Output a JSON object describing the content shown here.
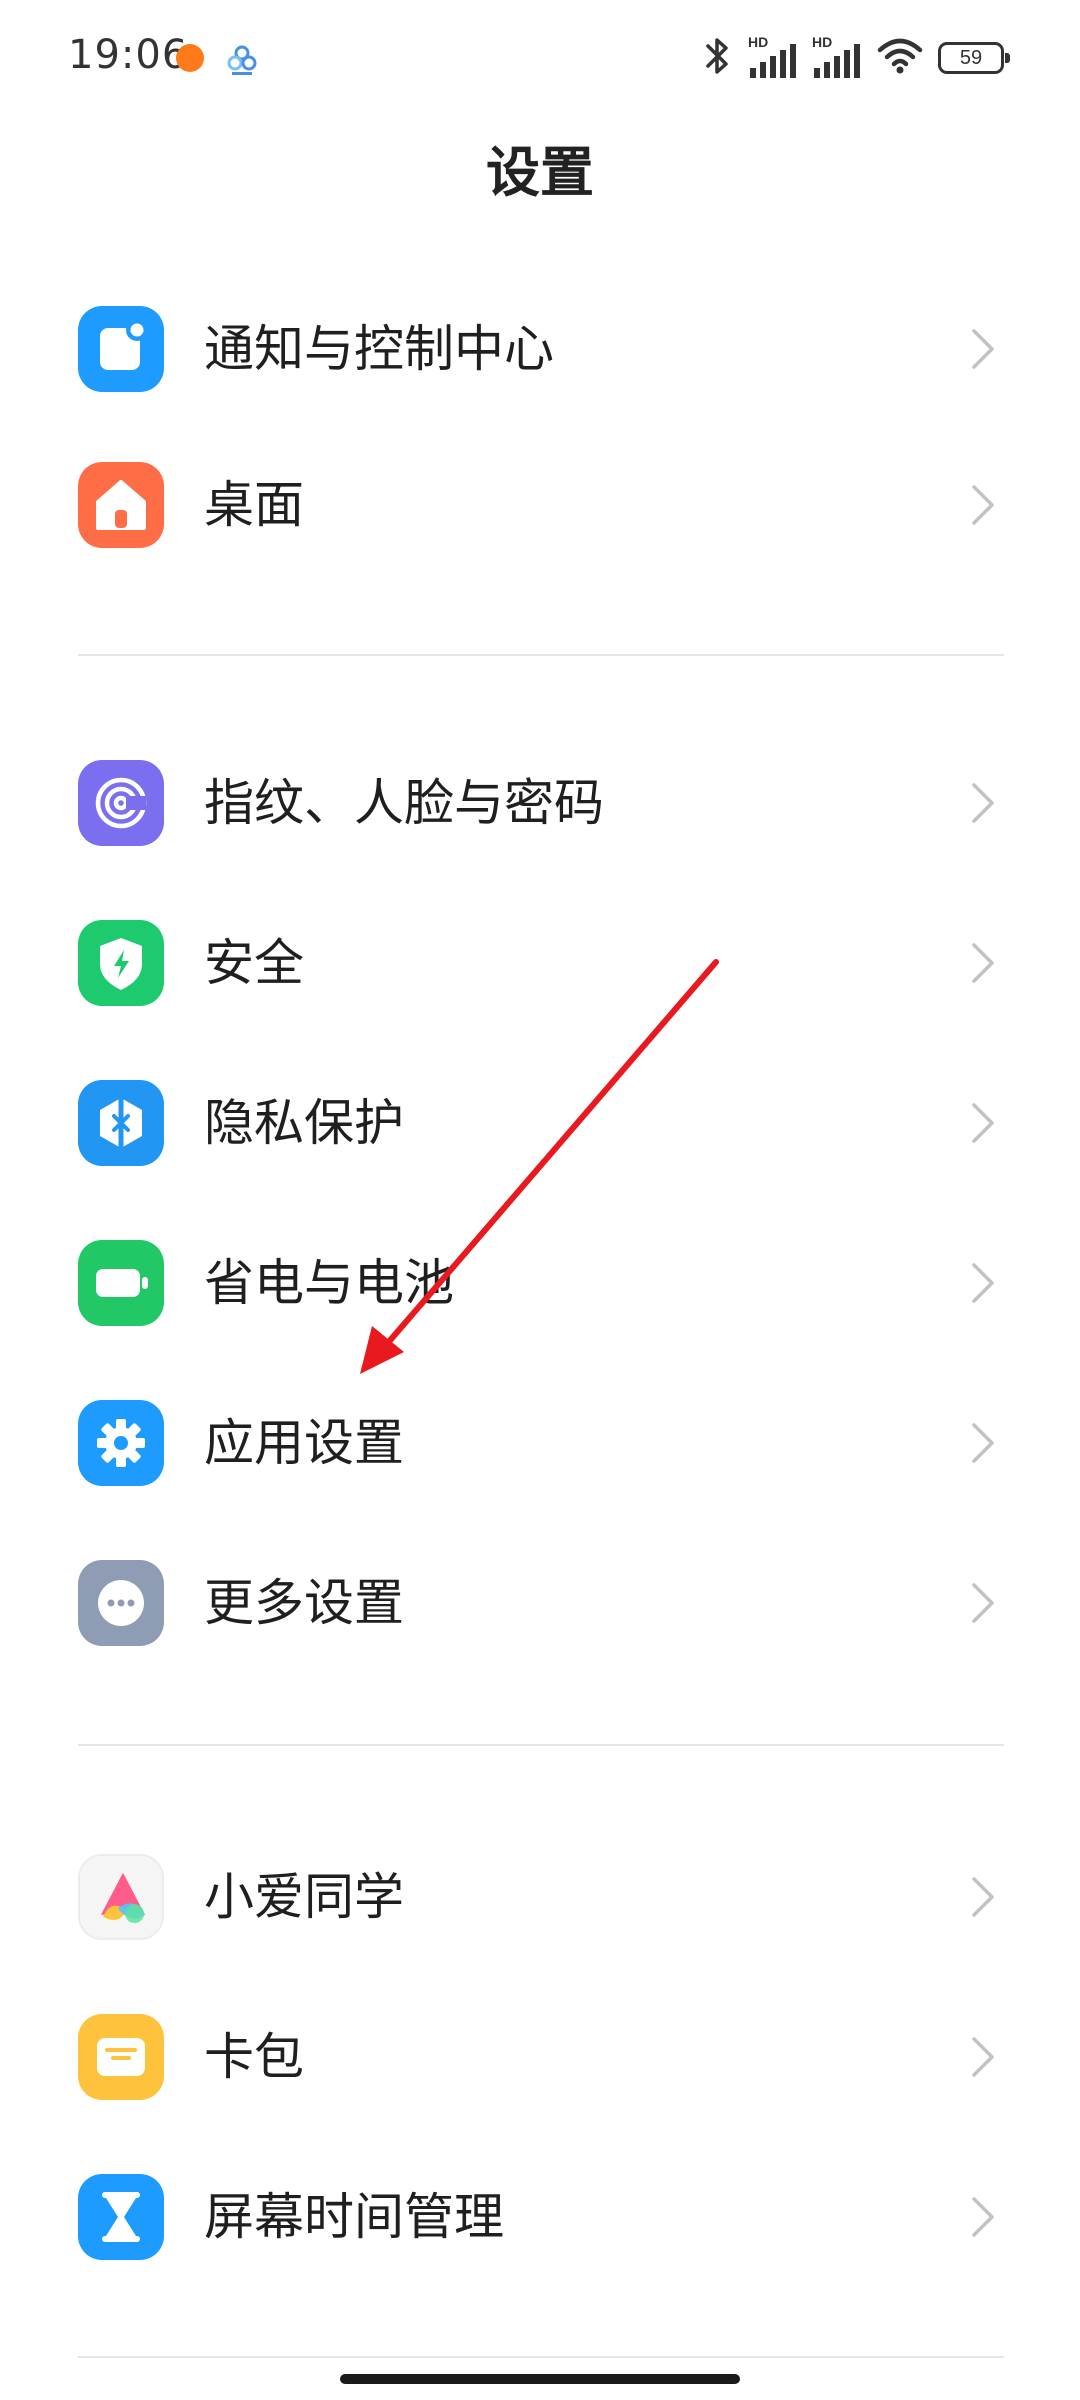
{
  "status_bar": {
    "time": "19:06",
    "battery": "59",
    "signal_badge_1": "HD",
    "signal_badge_2": "HD"
  },
  "header": {
    "title": "设置"
  },
  "settings": {
    "items": [
      {
        "label": "通知与控制中心",
        "icon": "notification-icon",
        "color": "#1E9BFF"
      },
      {
        "label": "桌面",
        "icon": "home-icon",
        "color": "#FF6D47"
      },
      {
        "label": "指纹、人脸与密码",
        "icon": "fingerprint-icon",
        "color": "#7B6FF0"
      },
      {
        "label": "安全",
        "icon": "shield-icon",
        "color": "#1DCB6E"
      },
      {
        "label": "隐私保护",
        "icon": "privacy-icon",
        "color": "#2196F3"
      },
      {
        "label": "省电与电池",
        "icon": "battery-icon",
        "color": "#22C766"
      },
      {
        "label": "应用设置",
        "icon": "gear-icon",
        "color": "#1E9BFF"
      },
      {
        "label": "更多设置",
        "icon": "more-icon",
        "color": "#8E9DB3"
      },
      {
        "label": "小爱同学",
        "icon": "xiaoai-icon",
        "color": "#F5F5F5"
      },
      {
        "label": "卡包",
        "icon": "wallet-icon",
        "color": "#FFC23D"
      },
      {
        "label": "屏幕时间管理",
        "icon": "hourglass-icon",
        "color": "#1E9BFF"
      }
    ]
  },
  "annotation": {
    "arrow_color": "#E8191F",
    "points_to": "应用设置"
  }
}
